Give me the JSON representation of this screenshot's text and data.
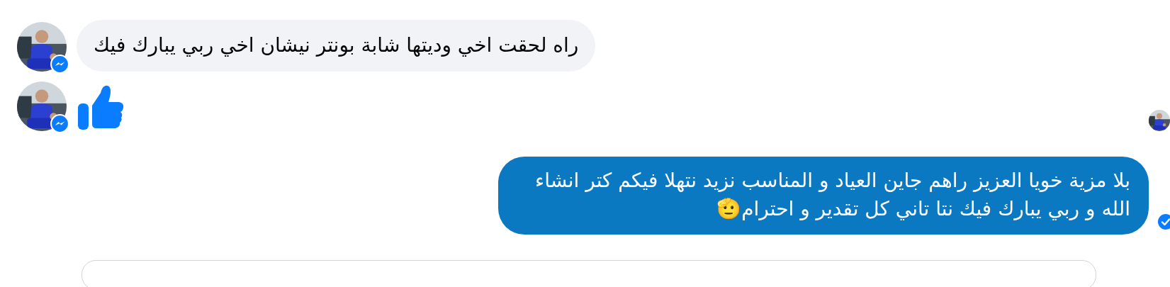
{
  "messages": [
    {
      "kind": "text",
      "outgoing": false,
      "avatar": true,
      "text": "راه لحقت اخي وديتها شابة بونتر نيشان اخي ربي يبارك فيك"
    },
    {
      "kind": "like",
      "outgoing": false,
      "avatar": true,
      "seen": true
    },
    {
      "kind": "text",
      "outgoing": true,
      "avatar": false,
      "delivered": true,
      "text": "بلا مزية خويا العزيز راهم جاين العياد و المناسب نزيد نتهلا فيكم كتر انشاء الله و ربي يبارك فيك نتا تاني كل تقدير و احترام🫡"
    }
  ],
  "composer": {
    "kind": "field"
  }
}
